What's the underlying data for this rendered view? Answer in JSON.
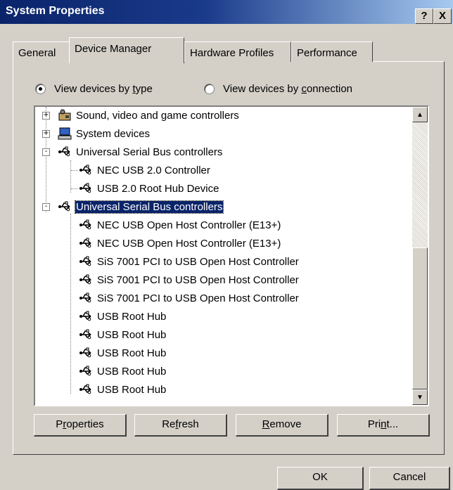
{
  "window": {
    "title": "System Properties",
    "help_label": "?",
    "close_label": "X"
  },
  "tabs": [
    {
      "label": "General",
      "active": false
    },
    {
      "label": "Device Manager",
      "active": true
    },
    {
      "label": "Hardware Profiles",
      "active": false
    },
    {
      "label": "Performance",
      "active": false
    }
  ],
  "view_options": {
    "by_type": {
      "pre": "View devices by ",
      "key": "t",
      "post": "ype",
      "selected": true
    },
    "by_connection": {
      "pre": "View devices by ",
      "key": "c",
      "post": "onnection",
      "selected": false
    }
  },
  "tree": {
    "items": [
      {
        "label": "Sound, video and game controllers",
        "icon": "sound-icon",
        "expander": "+"
      },
      {
        "label": "System devices",
        "icon": "computer-icon",
        "expander": "+"
      },
      {
        "label": "Universal Serial Bus controllers",
        "icon": "usb-icon",
        "expander": "-"
      },
      {
        "label": "NEC USB 2.0 Controller",
        "icon": "usb-icon"
      },
      {
        "label": "USB 2.0 Root Hub Device",
        "icon": "usb-icon"
      },
      {
        "label": "Universal Serial Bus controllers",
        "icon": "usb-icon",
        "expander": "-",
        "selected": true
      },
      {
        "label": "NEC USB Open Host Controller (E13+)",
        "icon": "usb-icon"
      },
      {
        "label": "NEC USB Open Host Controller (E13+)",
        "icon": "usb-icon"
      },
      {
        "label": "SiS 7001 PCI to USB Open Host Controller",
        "icon": "usb-icon"
      },
      {
        "label": "SiS 7001 PCI to USB Open Host Controller",
        "icon": "usb-icon"
      },
      {
        "label": "SiS 7001 PCI to USB Open Host Controller",
        "icon": "usb-icon"
      },
      {
        "label": "USB Root Hub",
        "icon": "usb-icon"
      },
      {
        "label": "USB Root Hub",
        "icon": "usb-icon"
      },
      {
        "label": "USB Root Hub",
        "icon": "usb-icon"
      },
      {
        "label": "USB Root Hub",
        "icon": "usb-icon"
      },
      {
        "label": "USB Root Hub",
        "icon": "usb-icon"
      }
    ]
  },
  "buttons": {
    "properties": {
      "pre": "P",
      "key": "r",
      "post": "operties"
    },
    "refresh": {
      "pre": "Re",
      "key": "f",
      "post": "resh"
    },
    "remove": {
      "pre": "",
      "key": "R",
      "post": "emove"
    },
    "print": {
      "pre": "Pri",
      "key": "n",
      "post": "t..."
    },
    "ok": "OK",
    "cancel": "Cancel"
  },
  "colors": {
    "title_start": "#0a246a",
    "title_end": "#a6caf0",
    "selection": "#0a246a",
    "face": "#d4d0c8"
  }
}
